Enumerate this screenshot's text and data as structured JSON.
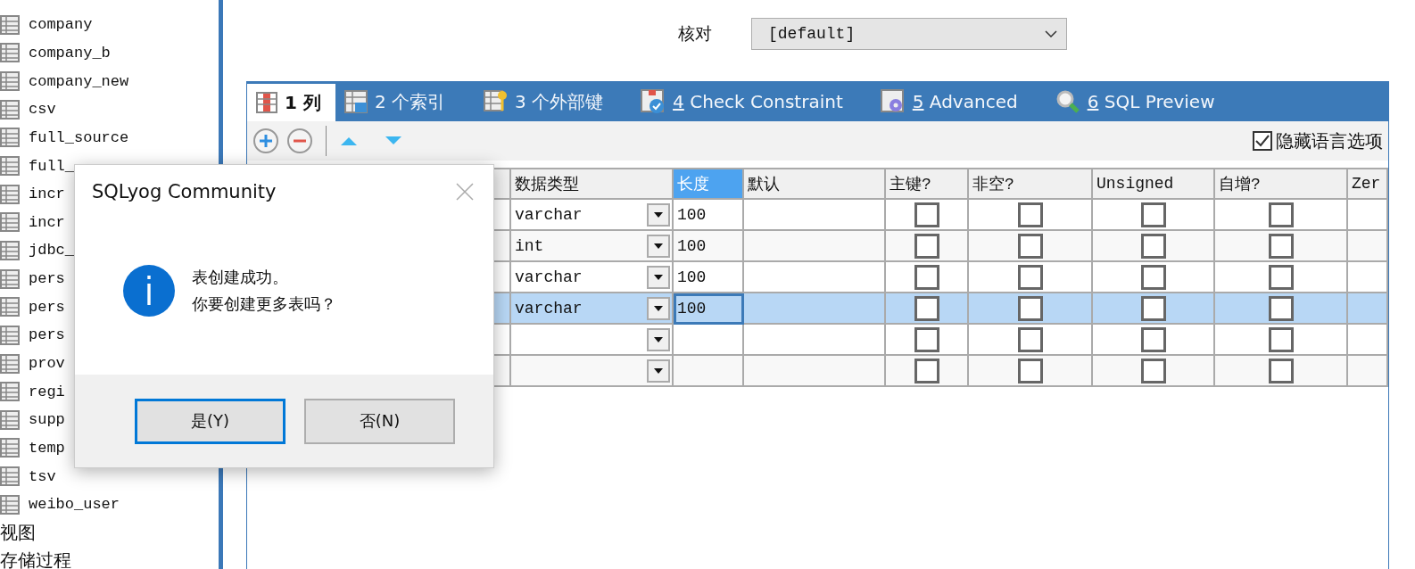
{
  "sidebar": {
    "items": [
      {
        "kind": "table",
        "name": "company"
      },
      {
        "kind": "table",
        "name": "company_b"
      },
      {
        "kind": "table",
        "name": "company_new"
      },
      {
        "kind": "table",
        "name": "csv"
      },
      {
        "kind": "table",
        "name": "full_source"
      },
      {
        "kind": "table",
        "name": "full_"
      },
      {
        "kind": "table",
        "name": "incr"
      },
      {
        "kind": "table",
        "name": "incr"
      },
      {
        "kind": "table",
        "name": "jdbc_"
      },
      {
        "kind": "table",
        "name": "pers"
      },
      {
        "kind": "table",
        "name": "pers"
      },
      {
        "kind": "table",
        "name": "pers"
      },
      {
        "kind": "table",
        "name": "prov"
      },
      {
        "kind": "table",
        "name": "regi"
      },
      {
        "kind": "table",
        "name": "supp"
      },
      {
        "kind": "table",
        "name": "temp"
      },
      {
        "kind": "table",
        "name": "tsv"
      },
      {
        "kind": "table",
        "name": "weibo_user"
      },
      {
        "kind": "folder",
        "name": "视图"
      },
      {
        "kind": "folder",
        "name": "存储过程"
      }
    ]
  },
  "collation": {
    "label": "核对",
    "value": "[default]"
  },
  "tabs": [
    {
      "number": "1",
      "label": "列",
      "kind": "columns",
      "selected": true,
      "access_key": false
    },
    {
      "number": "2",
      "label": "个索引",
      "kind": "indexes",
      "selected": false,
      "access_key": false
    },
    {
      "number": "3",
      "label": "个外部键",
      "kind": "keys",
      "selected": false,
      "access_key": false
    },
    {
      "number": "4",
      "label": "Check Constraint",
      "kind": "check",
      "selected": false,
      "access_key": true
    },
    {
      "number": "5",
      "label": "Advanced",
      "kind": "advanced",
      "selected": false,
      "access_key": true
    },
    {
      "number": "6",
      "label": "SQL Preview",
      "kind": "preview",
      "selected": false,
      "access_key": true
    }
  ],
  "hide_language_options": {
    "label": "隐藏语言选项",
    "checked": true
  },
  "grid": {
    "columns": [
      {
        "label": "数据类型",
        "kind": "type",
        "selected": false
      },
      {
        "label": "长度",
        "kind": "text",
        "selected": true
      },
      {
        "label": "默认",
        "kind": "text",
        "selected": false
      },
      {
        "label": "主键?",
        "kind": "check",
        "selected": false
      },
      {
        "label": "非空?",
        "kind": "check",
        "selected": false
      },
      {
        "label": "Unsigned",
        "kind": "check",
        "selected": false
      },
      {
        "label": "自增?",
        "kind": "check",
        "selected": false
      },
      {
        "label": "Zer",
        "kind": "text",
        "selected": false
      }
    ],
    "rows": [
      {
        "selected": false,
        "data_type": "varchar",
        "length": "100",
        "primary_key": false,
        "not_null": false,
        "unsigned": false,
        "auto_increment": false
      },
      {
        "selected": false,
        "data_type": "int",
        "length": "100",
        "primary_key": false,
        "not_null": false,
        "unsigned": false,
        "auto_increment": false
      },
      {
        "selected": false,
        "data_type": "varchar",
        "length": "100",
        "primary_key": false,
        "not_null": false,
        "unsigned": false,
        "auto_increment": false
      },
      {
        "selected": true,
        "data_type": "varchar",
        "length": "100",
        "primary_key": false,
        "not_null": false,
        "unsigned": false,
        "auto_increment": false
      },
      {
        "selected": false,
        "primary_key": false,
        "not_null": false,
        "unsigned": false,
        "auto_increment": false
      },
      {
        "selected": false,
        "primary_key": false,
        "not_null": false,
        "unsigned": false,
        "auto_increment": false
      }
    ]
  },
  "dialog": {
    "title": "SQLyog Community",
    "message": [
      "表创建成功。",
      "你要创建更多表吗？"
    ],
    "buttons": [
      {
        "label": "是(Y)",
        "default": true
      },
      {
        "label": "否(N)",
        "default": false
      }
    ]
  }
}
